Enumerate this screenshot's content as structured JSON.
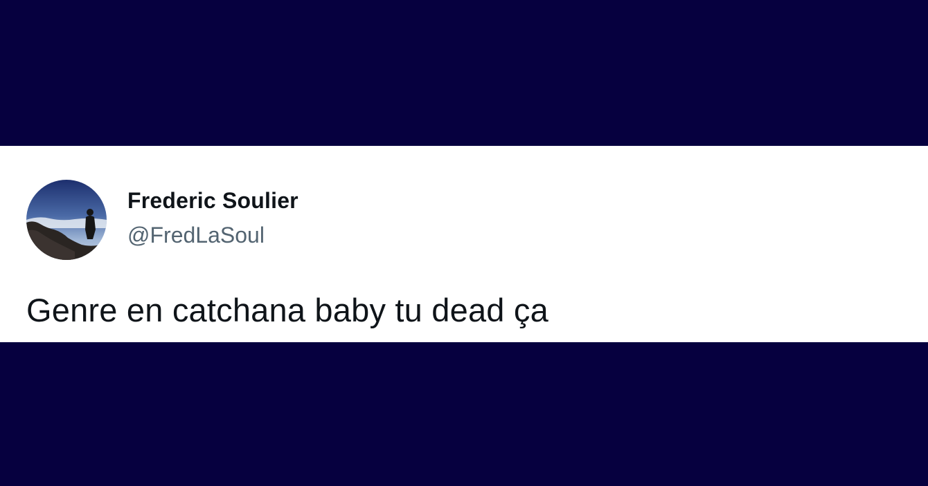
{
  "colors": {
    "background": "#06003f",
    "card": "#ffffff",
    "name": "#0f1419",
    "handle": "#536471",
    "text": "#0f1419"
  },
  "tweet": {
    "avatar_icon": "profile-photo-silhouette-mountain",
    "display_name": "Frederic Soulier",
    "handle": "@FredLaSoul",
    "text": "Genre en catchana baby tu dead ça"
  }
}
